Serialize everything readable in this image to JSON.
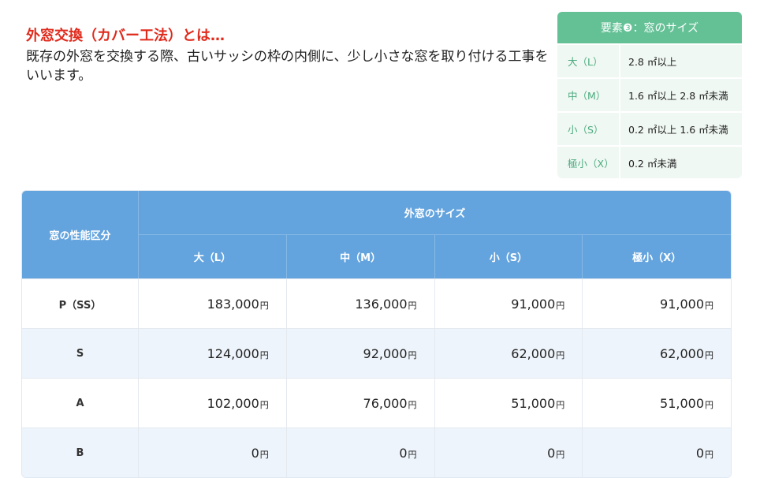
{
  "intro": {
    "title": "外窓交換（カバー工法）とは…",
    "body": "既存の外窓を交換する際、古いサッシの枠の内側に、少し小さな窓を取り付ける工事をいいます。"
  },
  "size_box": {
    "title": "要素❸：窓のサイズ",
    "rows": [
      {
        "key": "大（L）",
        "value": "2.8 ㎡以上"
      },
      {
        "key": "中（M）",
        "value": "1.6 ㎡以上 2.8 ㎡未満"
      },
      {
        "key": "小（S）",
        "value": "0.2 ㎡以上 1.6 ㎡未満"
      },
      {
        "key": "極小（X）",
        "value": "0.2 ㎡未満"
      }
    ]
  },
  "price_table": {
    "category_header": "窓の性能区分",
    "group_header": "外窓のサイズ",
    "size_headers": [
      "大（L）",
      "中（M）",
      "小（S）",
      "極小（X）"
    ],
    "unit": "円",
    "rows": [
      {
        "category": "P（SS）",
        "prices": [
          "183,000",
          "136,000",
          "91,000",
          "91,000"
        ]
      },
      {
        "category": "S",
        "prices": [
          "124,000",
          "92,000",
          "62,000",
          "62,000"
        ]
      },
      {
        "category": "A",
        "prices": [
          "102,000",
          "76,000",
          "51,000",
          "51,000"
        ]
      },
      {
        "category": "B",
        "prices": [
          "0",
          "0",
          "0",
          "0"
        ]
      }
    ]
  },
  "colors": {
    "title_red": "#e02a1c",
    "table_header_blue": "#64a4de",
    "size_box_green": "#64c196"
  }
}
